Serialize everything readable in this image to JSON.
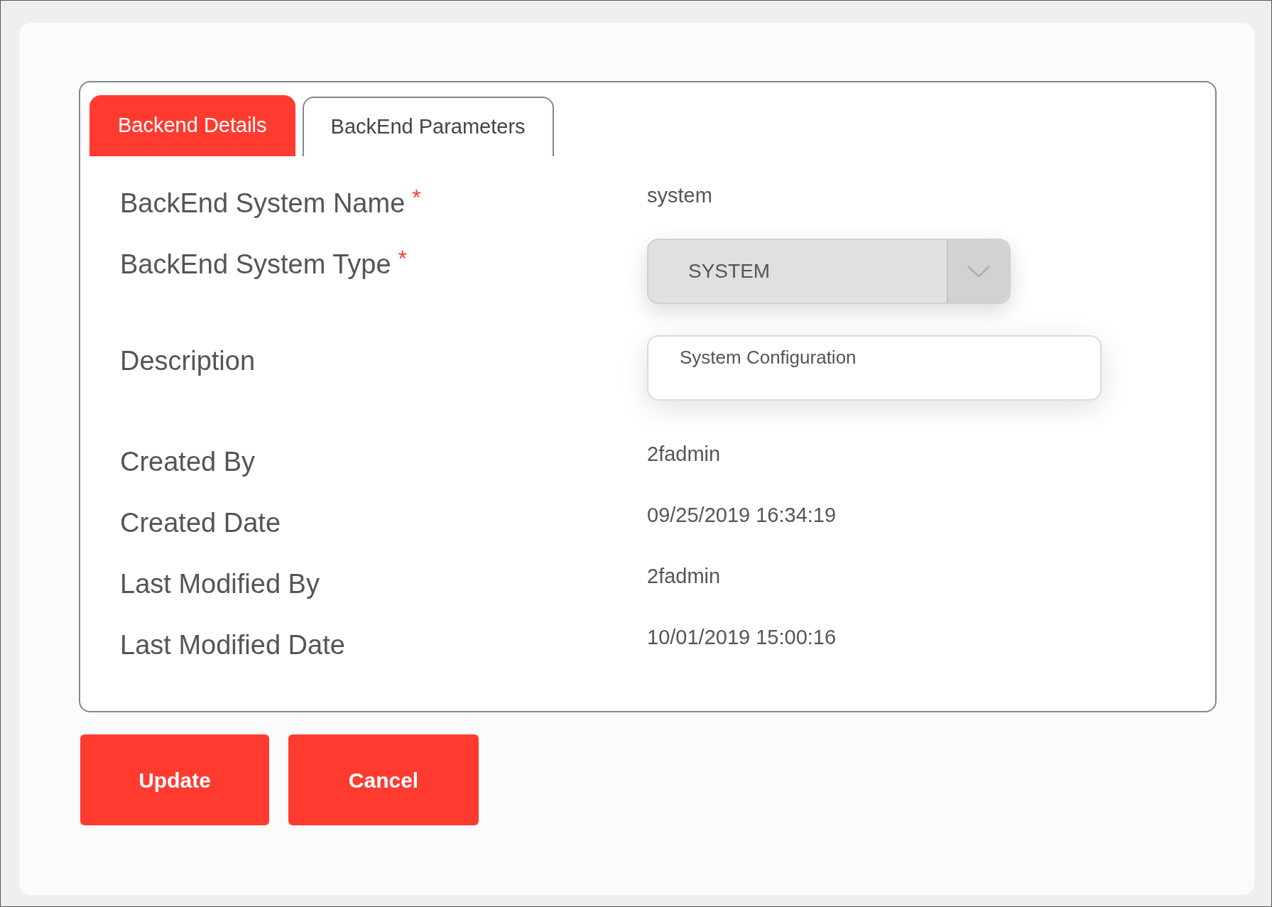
{
  "tabs": [
    {
      "label": "Backend Details",
      "selected": true
    },
    {
      "label": "BackEnd Parameters",
      "selected": false
    }
  ],
  "fields": [
    {
      "kind": "text",
      "label": "BackEnd System Name",
      "required_mark": "*",
      "value": "system"
    },
    {
      "kind": "select",
      "label": "BackEnd System Type",
      "required_mark": "*",
      "value": "SYSTEM"
    },
    {
      "kind": "input",
      "label": "Description",
      "value": "System Configuration"
    },
    {
      "kind": "text",
      "label": "Created By",
      "value": "2fadmin"
    },
    {
      "kind": "text",
      "label": "Created Date",
      "value": "09/25/2019 16:34:19"
    },
    {
      "kind": "text",
      "label": "Last Modified By",
      "value": "2fadmin"
    },
    {
      "kind": "text",
      "label": "Last Modified Date",
      "value": "10/01/2019 15:00:16"
    }
  ],
  "buttons": [
    "Update",
    "Cancel"
  ]
}
